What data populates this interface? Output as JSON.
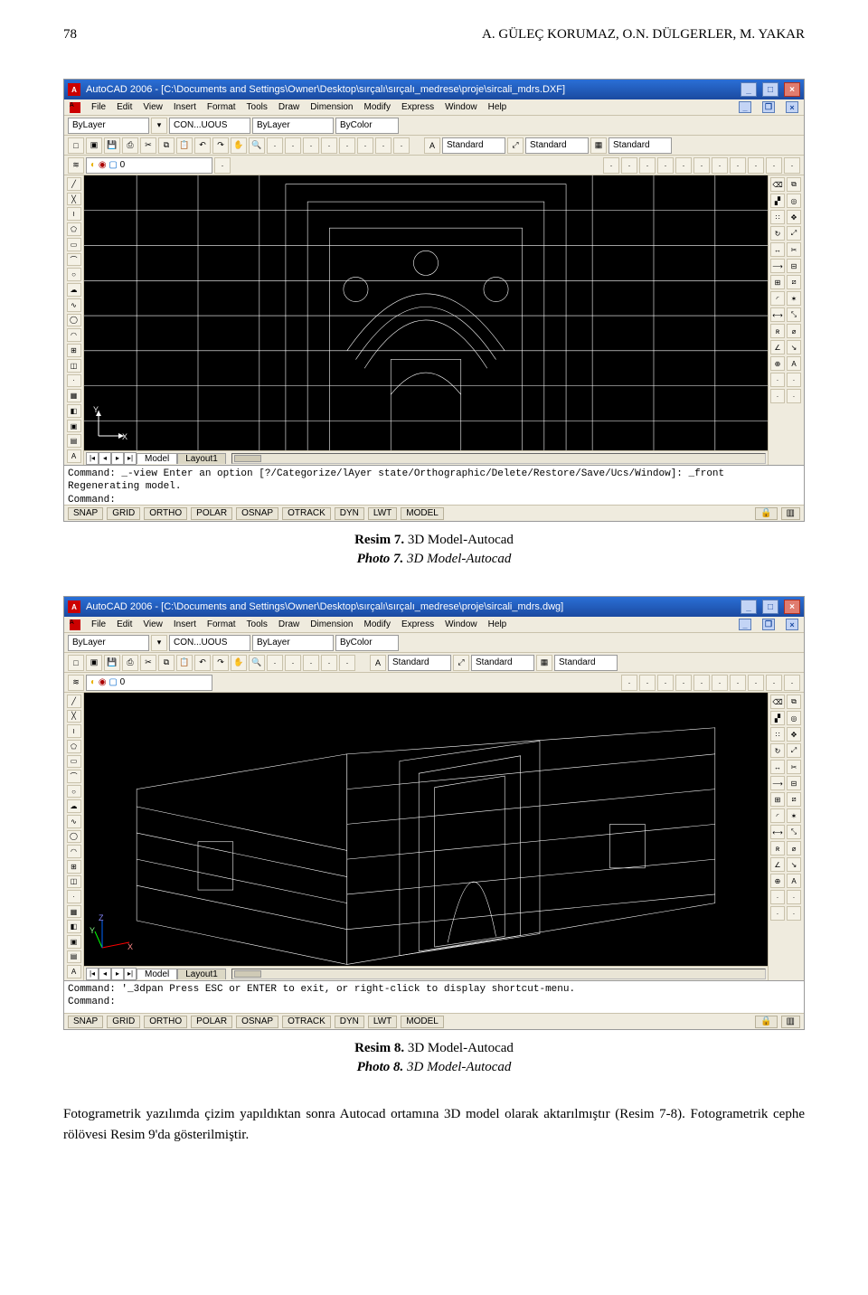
{
  "page": {
    "number": "78",
    "authors": "A. GÜLEÇ KORUMAZ, O.N. DÜLGERLER, M. YAKAR"
  },
  "figure7": {
    "caption_label": "Resim 7.",
    "caption_text": "3D Model-Autocad",
    "photo_label": "Photo 7.",
    "photo_text": "3D Model-Autocad"
  },
  "figure8": {
    "caption_label": "Resim 8.",
    "caption_text": "3D Model-Autocad",
    "photo_label": "Photo 8.",
    "photo_text": "3D Model-Autocad"
  },
  "body_text": "Fotogrametrik yazılımda çizim yapıldıktan sonra Autocad ortamına 3D model olarak aktarılmıştır (Resim 7-8). Fotogrametrik cephe rölövesi Resim 9'da gösterilmiştir.",
  "acad7": {
    "title": "AutoCAD 2006 - [C:\\Documents and Settings\\Owner\\Desktop\\sırçalı\\sırçalı_medrese\\proje\\sircali_mdrs.DXF]",
    "menus": [
      "File",
      "Edit",
      "View",
      "Insert",
      "Format",
      "Tools",
      "Draw",
      "Dimension",
      "Modify",
      "Express",
      "Window",
      "Help"
    ],
    "layer_ctl": "ByLayer",
    "linetype_ctl": "CON...UOUS",
    "lw_ctl": "ByLayer",
    "color_ctl": "ByColor",
    "style1": "Standard",
    "style2": "Standard",
    "style3": "Standard",
    "layer_state": "0",
    "tabs": {
      "model": "Model",
      "layout": "Layout1"
    },
    "cmd1": "Command: _-view Enter an option [?/Categorize/lAyer state/Orthographic/Delete/Restore/Save/Ucs/Window]: _front Regenerating model.",
    "cmd2": "Command:",
    "ucs": {
      "x": "X",
      "y": "Y"
    }
  },
  "acad8": {
    "title": "AutoCAD 2006 - [C:\\Documents and Settings\\Owner\\Desktop\\sırçalı\\sırçalı_medrese\\proje\\sircali_mdrs.dwg]",
    "menus": [
      "File",
      "Edit",
      "View",
      "Insert",
      "Format",
      "Tools",
      "Draw",
      "Dimension",
      "Modify",
      "Express",
      "Window",
      "Help"
    ],
    "layer_ctl": "ByLayer",
    "linetype_ctl": "CON...UOUS",
    "lw_ctl": "ByLayer",
    "color_ctl": "ByColor",
    "style1": "Standard",
    "style2": "Standard",
    "style3": "Standard",
    "layer_state": "0",
    "tabs": {
      "model": "Model",
      "layout": "Layout1"
    },
    "cmd1": "Command: '_3dpan Press ESC or ENTER to exit, or right-click to display shortcut-menu.",
    "cmd2": "Command:",
    "ucs": {
      "x": "X",
      "y": "Y",
      "z": "Z"
    }
  },
  "status_buttons": [
    "SNAP",
    "GRID",
    "ORTHO",
    "POLAR",
    "OSNAP",
    "OTRACK",
    "DYN",
    "LWT",
    "MODEL"
  ]
}
